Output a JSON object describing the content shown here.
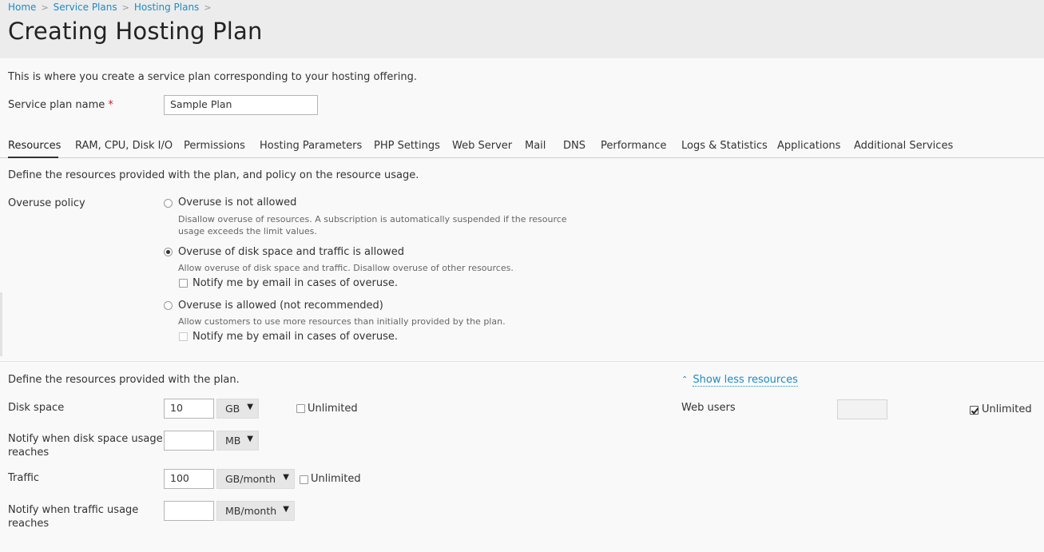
{
  "breadcrumb": {
    "items": [
      "Home",
      "Service Plans",
      "Hosting Plans"
    ],
    "separator": ">"
  },
  "page_title": "Creating Hosting Plan",
  "intro_text": "This is where you create a service plan corresponding to your hosting offering.",
  "service_plan": {
    "label": "Service plan name",
    "required_marker": "*",
    "value": "Sample Plan"
  },
  "tabs": [
    {
      "label": "Resources",
      "active": true
    },
    {
      "label": "RAM, CPU, Disk I/O"
    },
    {
      "label": "Permissions"
    },
    {
      "label": "Hosting Parameters"
    },
    {
      "label": "PHP Settings"
    },
    {
      "label": "Web Server"
    },
    {
      "label": "Mail"
    },
    {
      "label": "DNS"
    },
    {
      "label": "Performance"
    },
    {
      "label": "Logs & Statistics"
    },
    {
      "label": "Applications"
    },
    {
      "label": "Additional Services"
    }
  ],
  "resources_intro": "Define the resources provided with the plan, and policy on the resource usage.",
  "overuse": {
    "label": "Overuse policy",
    "options": [
      {
        "label": "Overuse is not allowed",
        "hint_line1": "Disallow overuse of resources. A subscription is automatically suspended if the resource",
        "hint_line2": "usage exceeds the limit values.",
        "selected": false
      },
      {
        "label": "Overuse of disk space and traffic is allowed",
        "hint": "Allow overuse of disk space and traffic. Disallow overuse of other resources.",
        "notify_label": "Notify me by email in cases of overuse.",
        "selected": true
      },
      {
        "label": "Overuse is allowed (not recommended)",
        "hint": "Allow customers to use more resources than initially provided by the plan.",
        "notify_label": "Notify me by email in cases of overuse.",
        "selected": false
      }
    ]
  },
  "limits": {
    "intro": "Define the resources provided with the plan.",
    "toggle_link": "Show less resources",
    "toggle_icon": "chevron-up-icon",
    "unlimited_label": "Unlimited",
    "disk_space": {
      "label": "Disk space",
      "value": "10",
      "unit": "GB",
      "unlimited": false
    },
    "disk_notify": {
      "label_line1": "Notify when disk space usage",
      "label_line2": "reaches",
      "value": "",
      "unit": "MB"
    },
    "traffic": {
      "label": "Traffic",
      "value": "100",
      "unit": "GB/month",
      "unlimited": false
    },
    "traffic_notify": {
      "label_line1": "Notify when traffic usage",
      "label_line2": "reaches",
      "value": "",
      "unit": "MB/month"
    },
    "web_users": {
      "label": "Web users",
      "value": "",
      "unlimited": true
    }
  },
  "colors": {
    "link": "#1e8bc3",
    "required": "#d02020",
    "header_bg": "#ececec",
    "page_bg": "#f9f9f9"
  }
}
